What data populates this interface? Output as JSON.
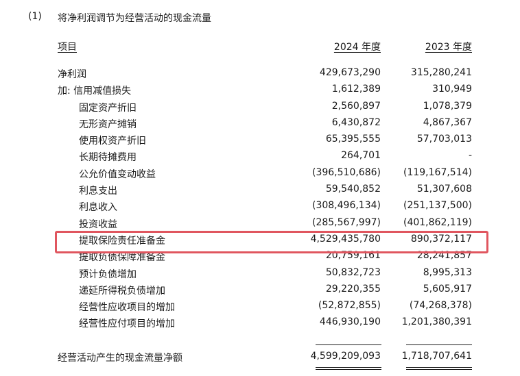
{
  "section": {
    "number": "(1)",
    "title": "将净利润调节为经营活动的现金流量"
  },
  "header": {
    "item": "项目",
    "col_2024": "2024 年度",
    "col_2023": "2023 年度"
  },
  "rows": [
    {
      "label": "净利润",
      "v2024": "429,673,290",
      "v2023": "315,280,241",
      "indent": 0
    },
    {
      "label": "加: 信用减值损失",
      "v2024": "1,612,389",
      "v2023": "310,949",
      "indent": 0
    },
    {
      "label": "固定资产折旧",
      "v2024": "2,560,897",
      "v2023": "1,078,379",
      "indent": 1
    },
    {
      "label": "无形资产摊销",
      "v2024": "6,430,872",
      "v2023": "4,867,367",
      "indent": 1
    },
    {
      "label": "使用权资产折旧",
      "v2024": "65,395,555",
      "v2023": "57,703,013",
      "indent": 1
    },
    {
      "label": "长期待摊费用",
      "v2024": "264,701",
      "v2023": "-",
      "indent": 1
    },
    {
      "label": "公允价值变动收益",
      "v2024": "(396,510,686)",
      "v2023": "(119,167,514)",
      "indent": 1
    },
    {
      "label": "利息支出",
      "v2024": "59,540,852",
      "v2023": "51,307,608",
      "indent": 1
    },
    {
      "label": "利息收入",
      "v2024": "(308,496,134)",
      "v2023": "(251,137,500)",
      "indent": 1
    },
    {
      "label": "投资收益",
      "v2024": "(285,567,997)",
      "v2023": "(401,862,119)",
      "indent": 1
    },
    {
      "label": "提取保险责任准备金",
      "v2024": "4,529,435,780",
      "v2023": "890,372,117",
      "indent": 1
    },
    {
      "label": "提取负债保障准备金",
      "v2024": "20,759,161",
      "v2023": "28,241,857",
      "indent": 1
    },
    {
      "label": "预计负债增加",
      "v2024": "50,832,723",
      "v2023": "8,995,313",
      "indent": 1
    },
    {
      "label": "递延所得税负债增加",
      "v2024": "29,220,355",
      "v2023": "5,605,917",
      "indent": 1
    },
    {
      "label": "经营性应收项目的增加",
      "v2024": "(52,872,855)",
      "v2023": "(74,268,378)",
      "indent": 1
    },
    {
      "label": "经营性应付项目的增加",
      "v2024": "446,930,190",
      "v2023": "1,201,380,391",
      "indent": 1
    }
  ],
  "total": {
    "label": "经营活动产生的现金流量净额",
    "v2024": "4,599,209,093",
    "v2023": "1,718,707,641"
  },
  "highlight_color": "#e0565f"
}
